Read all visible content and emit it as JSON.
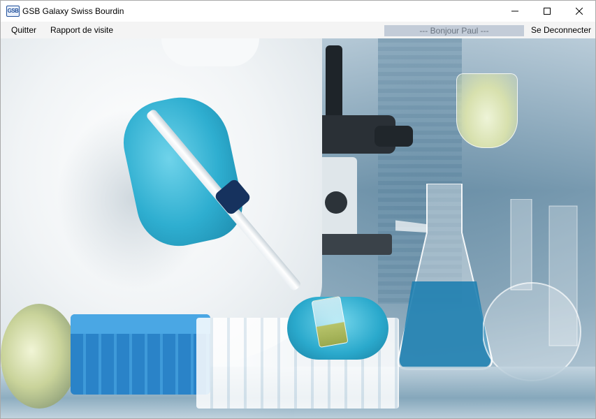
{
  "window": {
    "title": "GSB Galaxy Swiss Bourdin",
    "icon_text": "GSB",
    "controls": {
      "minimize": "minimize",
      "maximize": "maximize",
      "close": "close"
    }
  },
  "menubar": {
    "quit_label": "Quitter",
    "report_label": "Rapport de visite",
    "greeting": "--- Bonjour Paul ---",
    "logout_label": "Se Deconnecter"
  },
  "content": {
    "image_subject": "laboratory-photo",
    "accent_colors": {
      "glove": "#2eaed0",
      "liquid": "#1f7fb0",
      "greeting_bg": "#c3ccd8",
      "greeting_text": "#6a7480"
    }
  }
}
